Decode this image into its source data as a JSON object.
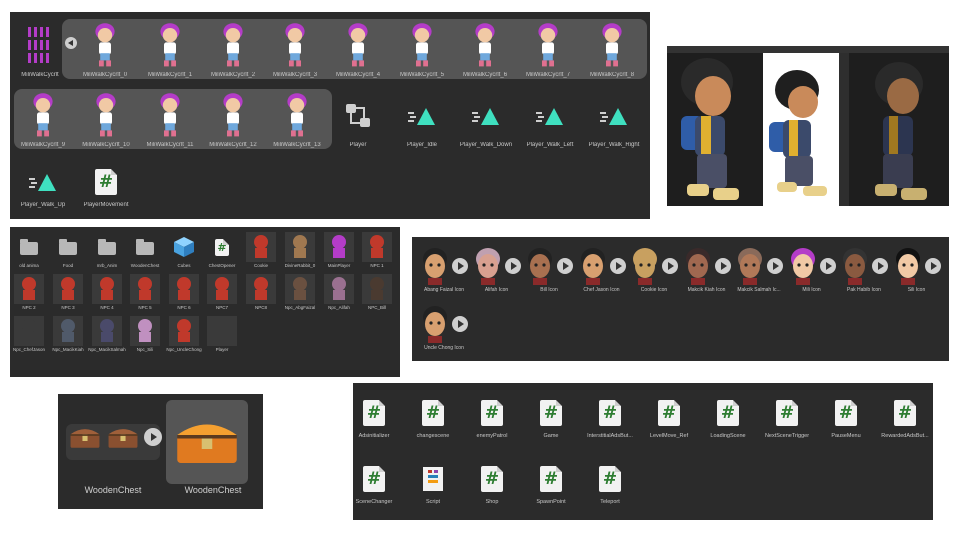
{
  "panel1": {
    "row1": [
      "MiliWalkCycrlt",
      "MiliWalkCycrlt_0",
      "MiliWalkCycrlt_1",
      "MiliWalkCycrlt_2",
      "MiliWalkCycrlt_3",
      "MiliWalkCycrlt_4",
      "MiliWalkCycrlt_5",
      "MiliWalkCycrlt_6",
      "MiliWalkCycrlt_7",
      "MiliWalkCycrlt_8"
    ],
    "row2": [
      "MiliWalkCycrlt_9",
      "MiliWalkCycrlt_10",
      "MiliWalkCycrlt_11",
      "MiliWalkCycrlt_12",
      "MiliWalkCycrlt_13",
      "Player",
      "Player_Idle",
      "Player_Walk_Down",
      "Player_Walk_Left",
      "Player_Walk_Right"
    ],
    "row3": [
      "Player_Walk_Up",
      "PlayerMovement"
    ]
  },
  "panel3": {
    "row1": [
      "old anima",
      "Food",
      "mrb_Anim",
      "WoodenChest",
      "Cubes",
      "ChestOpener",
      "Cookie",
      "DivineRabbit_0",
      "MainPlayer",
      "NPC 1"
    ],
    "row2": [
      "NPC 2",
      "NPC 3",
      "NPC 4",
      "NPC 5",
      "NPC 6",
      "NPC7",
      "NPC8",
      "Npc_AbgFaizal",
      "Npc_Alifah",
      "NPC_Bill"
    ],
    "row3": [
      "Npc_ChefJason",
      "Npc_MacikKiah",
      "Npc_MacikSalmah",
      "Npc_Sili",
      "Npc_UncleChong",
      "Player"
    ]
  },
  "panel4": {
    "row1": [
      "Abang Faizal Icon",
      "Alifah Icon",
      "Bill Icon",
      "Chef Jason Icon",
      "Cookie Icon",
      "Makcik Kiah Icon",
      "Makcik Salmah Ic...",
      "Mili Icon",
      "Pak Habib Icon",
      "Sili Icon"
    ],
    "row2": [
      "Uncle Chong Icon"
    ]
  },
  "panel5": {
    "items": [
      "WoodenChest",
      "WoodenChest"
    ]
  },
  "panel6": {
    "row1": [
      "Adsinitializer",
      "changescene",
      "enemyPatrol",
      "Game",
      "InterstitialAdsBut...",
      "LevelMove_Ref",
      "LoadingScene",
      "NextSceneTrigger",
      "PauseMenu",
      "RewardedAdsBut..."
    ],
    "row2": [
      "SceneChanger",
      "Script",
      "Shop",
      "SpawnPoint",
      "Teleport"
    ]
  },
  "colors": {
    "panel_bg": "#2b2b2b",
    "label": "#c8c8c8",
    "script_hash": "#2e7d32",
    "anim_triangle": "#3fe0c0",
    "mili_hair": "#b43cc8",
    "npc_red": "#c0392b"
  },
  "icons": {
    "script": "hash-script-icon",
    "folder": "folder-icon",
    "animation": "animation-clip-icon",
    "controller": "animator-controller-icon",
    "play": "play-icon",
    "back": "back-arrow-icon",
    "cube": "cube-icon"
  }
}
